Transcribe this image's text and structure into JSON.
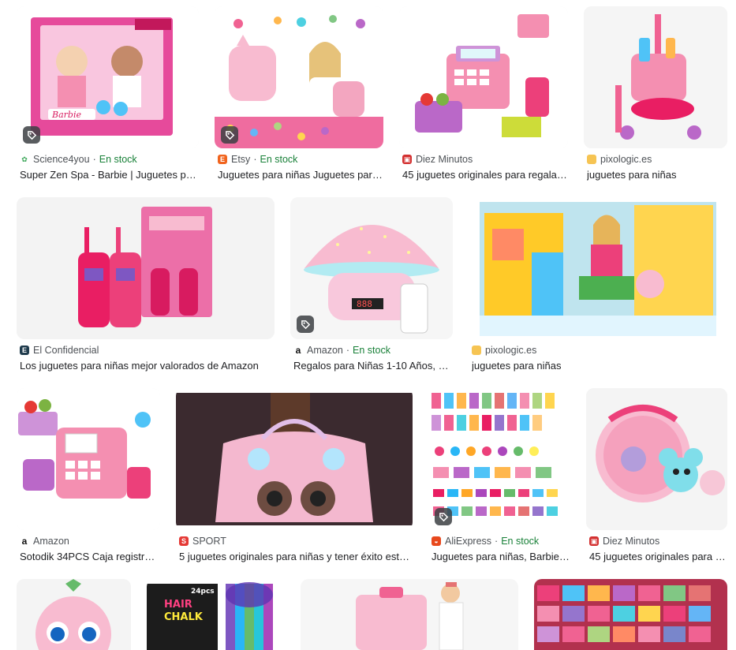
{
  "results": [
    {
      "source": "Science4you",
      "stock": "En stock",
      "title": "Super Zen Spa - Barbie | Juguetes para…",
      "fav_color": "#3aa657",
      "fav_icon": "leaf-icon",
      "thumb_color": "#f6b7d6"
    },
    {
      "source": "Etsy",
      "stock": "En stock",
      "title": "Juguetes para niñas Juguetes para …",
      "fav_color": "#f1641e",
      "fav_letter": "E",
      "thumb_color": "#f9d7e6"
    },
    {
      "source": "Diez Minutos",
      "stock": "",
      "title": "45 juguetes originales para regalar …",
      "fav_color": "#d32f2f",
      "thumb_color": "#fbe3ee"
    },
    {
      "source": "pixologic.es",
      "stock": "",
      "title": "juguetes para niñas",
      "fav_color": "#f6c453",
      "thumb_color": "#f3c7e4"
    },
    {
      "source": "El Confidencial",
      "stock": "",
      "title": "Los juguetes para niñas mejor valorados de Amazon",
      "fav_color": "#1f3b4d",
      "fav_letter": "E",
      "thumb_color": "#f8d3e6"
    },
    {
      "source": "Amazon",
      "stock": "En stock",
      "title": "Regalos para Niñas 1-10 Años, Ju…",
      "fav_color": "#ffffff",
      "fav_letter": "a",
      "thumb_color": "#f7d7e3"
    },
    {
      "source": "pixologic.es",
      "stock": "",
      "title": "juguetes para niñas",
      "fav_color": "#f6c453",
      "thumb_color": "#9fd3c7"
    },
    {
      "source": "Amazon",
      "stock": "",
      "title": "Sotodik 34PCS Caja registrad…",
      "fav_color": "#ffffff",
      "fav_letter": "a",
      "thumb_color": "#fce4ef"
    },
    {
      "source": "SPORT",
      "stock": "",
      "title": "5 juguetes originales para niñas y tener éxito esta …",
      "fav_color": "#e53935",
      "fav_letter": "S",
      "thumb_color": "#e9b8c9"
    },
    {
      "source": "AliExpress",
      "stock": "En stock",
      "title": "Juguetes para niñas, Barbies, …",
      "fav_color": "#e8491d",
      "thumb_color": "#fde7f1"
    },
    {
      "source": "Diez Minutos",
      "stock": "",
      "title": "45 juguetes originales para regalar a r…",
      "fav_color": "#d32f2f",
      "thumb_color": "#f6d9e8"
    },
    {
      "thumb_color": "#f4c6da"
    },
    {
      "thumb_color": "#1e1e1e"
    },
    {
      "thumb_color": "#f7e9ef"
    },
    {
      "thumb_color": "#d96b8a"
    }
  ]
}
